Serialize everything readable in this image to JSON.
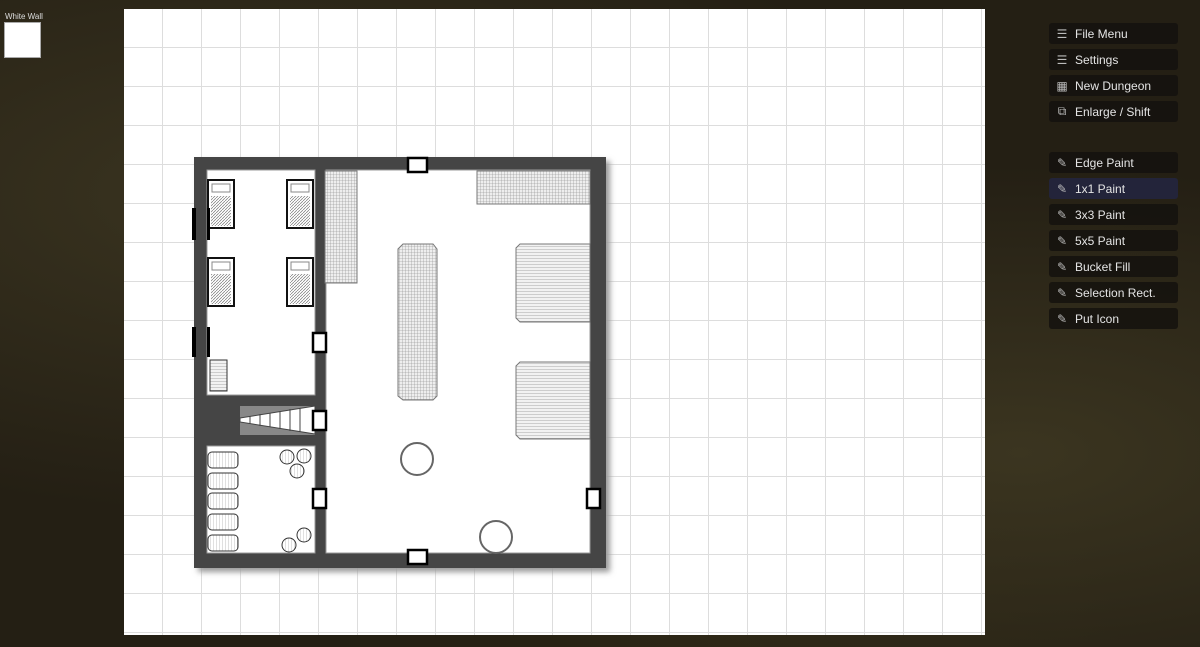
{
  "swatch": {
    "label": "White Wall",
    "color": "#ffffff"
  },
  "menu_top": [
    {
      "label": "File Menu",
      "icon": "hamburger-icon"
    },
    {
      "label": "Settings",
      "icon": "hamburger-icon"
    },
    {
      "label": "New Dungeon",
      "icon": "grid-icon"
    },
    {
      "label": "Enlarge / Shift",
      "icon": "shift-icon"
    }
  ],
  "menu_tools": [
    {
      "label": "Edge Paint",
      "icon": "pencil-icon",
      "active": false
    },
    {
      "label": "1x1 Paint",
      "icon": "pencil-icon",
      "active": true
    },
    {
      "label": "3x3 Paint",
      "icon": "pencil-icon",
      "active": false
    },
    {
      "label": "5x5 Paint",
      "icon": "pencil-icon",
      "active": false
    },
    {
      "label": "Bucket Fill",
      "icon": "pencil-icon",
      "active": false
    },
    {
      "label": "Selection Rect.",
      "icon": "pencil-icon",
      "active": false
    },
    {
      "label": "Put Icon",
      "icon": "pencil-icon",
      "active": false
    }
  ],
  "colors": {
    "wall": "#454545",
    "active_tool": "#23243a"
  }
}
